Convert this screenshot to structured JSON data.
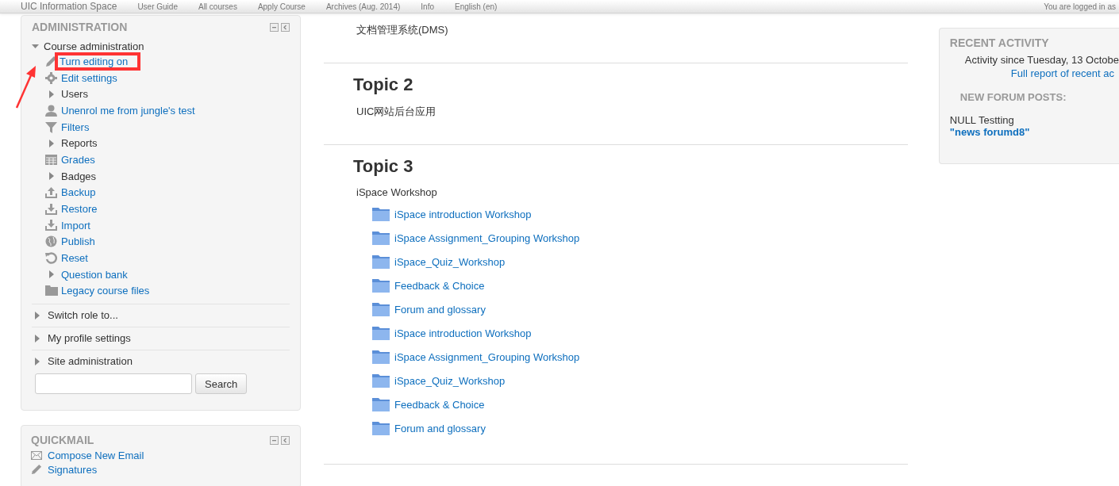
{
  "navbar": {
    "brand": "UIC Information Space",
    "items": [
      "User Guide",
      "All courses",
      "Apply Course",
      "Archives (Aug. 2014)",
      "Info",
      "English (en)"
    ],
    "login": "You are logged in as"
  },
  "administration": {
    "title": "ADMINISTRATION",
    "course_admin": {
      "label": "Course administration",
      "expanded": true,
      "items": [
        {
          "kind": "link",
          "label": "Turn editing on",
          "highlighted": true
        },
        {
          "kind": "link",
          "label": "Edit settings",
          "highlighted": false
        },
        {
          "kind": "branch",
          "label": "Users",
          "highlighted": false
        },
        {
          "kind": "link",
          "label": "Unenrol me from jungle's test",
          "highlighted": false
        },
        {
          "kind": "link",
          "label": "Filters",
          "highlighted": false
        },
        {
          "kind": "branch",
          "label": "Reports",
          "highlighted": false
        },
        {
          "kind": "link",
          "label": "Grades",
          "highlighted": false
        },
        {
          "kind": "branch",
          "label": "Badges",
          "highlighted": false
        },
        {
          "kind": "link",
          "label": "Backup",
          "highlighted": false
        },
        {
          "kind": "link",
          "label": "Restore",
          "highlighted": false
        },
        {
          "kind": "link",
          "label": "Import",
          "highlighted": false
        },
        {
          "kind": "link",
          "label": "Publish",
          "highlighted": false
        },
        {
          "kind": "link",
          "label": "Reset",
          "highlighted": false
        },
        {
          "kind": "branch-link",
          "label": "Question bank",
          "highlighted": false
        },
        {
          "kind": "link",
          "label": "Legacy course files",
          "highlighted": false
        }
      ]
    },
    "sections": [
      {
        "label": "Switch role to...",
        "expanded": false
      },
      {
        "label": "My profile settings",
        "expanded": false
      },
      {
        "label": "Site administration",
        "expanded": false
      }
    ],
    "search_button": "Search"
  },
  "quickmail": {
    "title": "QUICKMAIL",
    "items": [
      "Compose New Email",
      "Signatures"
    ]
  },
  "topics": [
    {
      "summary": "文档管理系统(DMS)"
    },
    {
      "title": "Topic 2",
      "summary": "UIC网站后台应用"
    },
    {
      "title": "Topic 3",
      "summary": "iSpace Workshop",
      "activities": [
        "iSpace introduction Workshop",
        "iSpace Assignment_Grouping Workshop",
        "iSpace_Quiz_Workshop",
        "Feedback & Choice",
        "Forum and glossary",
        "iSpace introduction Workshop",
        "iSpace Assignment_Grouping Workshop",
        "iSpace_Quiz_Workshop",
        "Feedback & Choice",
        "Forum and glossary"
      ]
    }
  ],
  "recent_activity": {
    "title": "RECENT ACTIVITY",
    "since": "Activity since Tuesday, 13 Octobe",
    "full_report": "Full report of recent ac",
    "forum_heading": "NEW FORUM POSTS:",
    "post_author": "NULL Testting",
    "post_title": "\"news forumd8\""
  }
}
